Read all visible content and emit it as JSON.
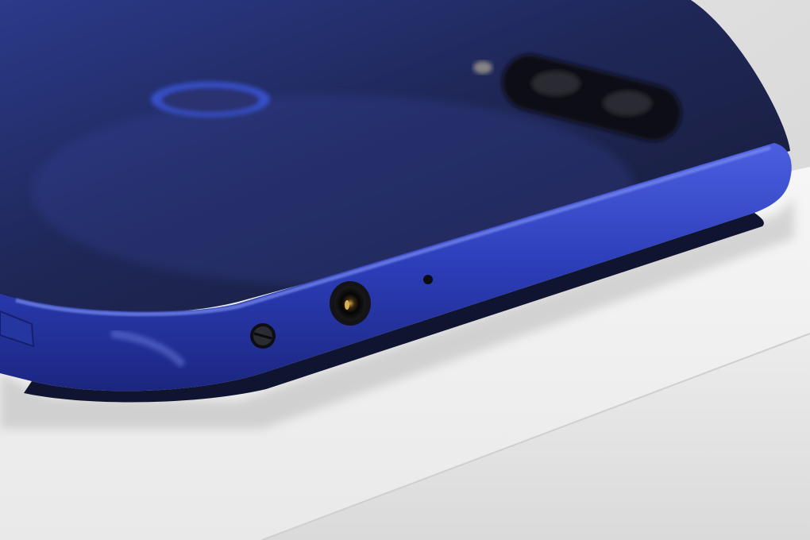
{
  "colors": {
    "background": "#dcdcdc",
    "surface_top": "#f2f2f2",
    "surface_front": "#e6e6e6",
    "phone_back_dark": "#1a1f3a",
    "phone_back_mid": "#2b356e",
    "phone_frame": "#2e3fb8",
    "phone_frame_highlight": "#5a6fe0",
    "port_dark": "#0b0b0f"
  },
  "elements": {
    "phone": "smartphone-back",
    "fingerprint": "fingerprint-sensor",
    "camera": "dual-camera-module",
    "flash": "led-flash",
    "headphone_jack": "headphone-jack",
    "microphone": "microphone-hole",
    "screw": "frame-screw",
    "side_button": "side-button",
    "pedestal": "white-pedestal"
  }
}
